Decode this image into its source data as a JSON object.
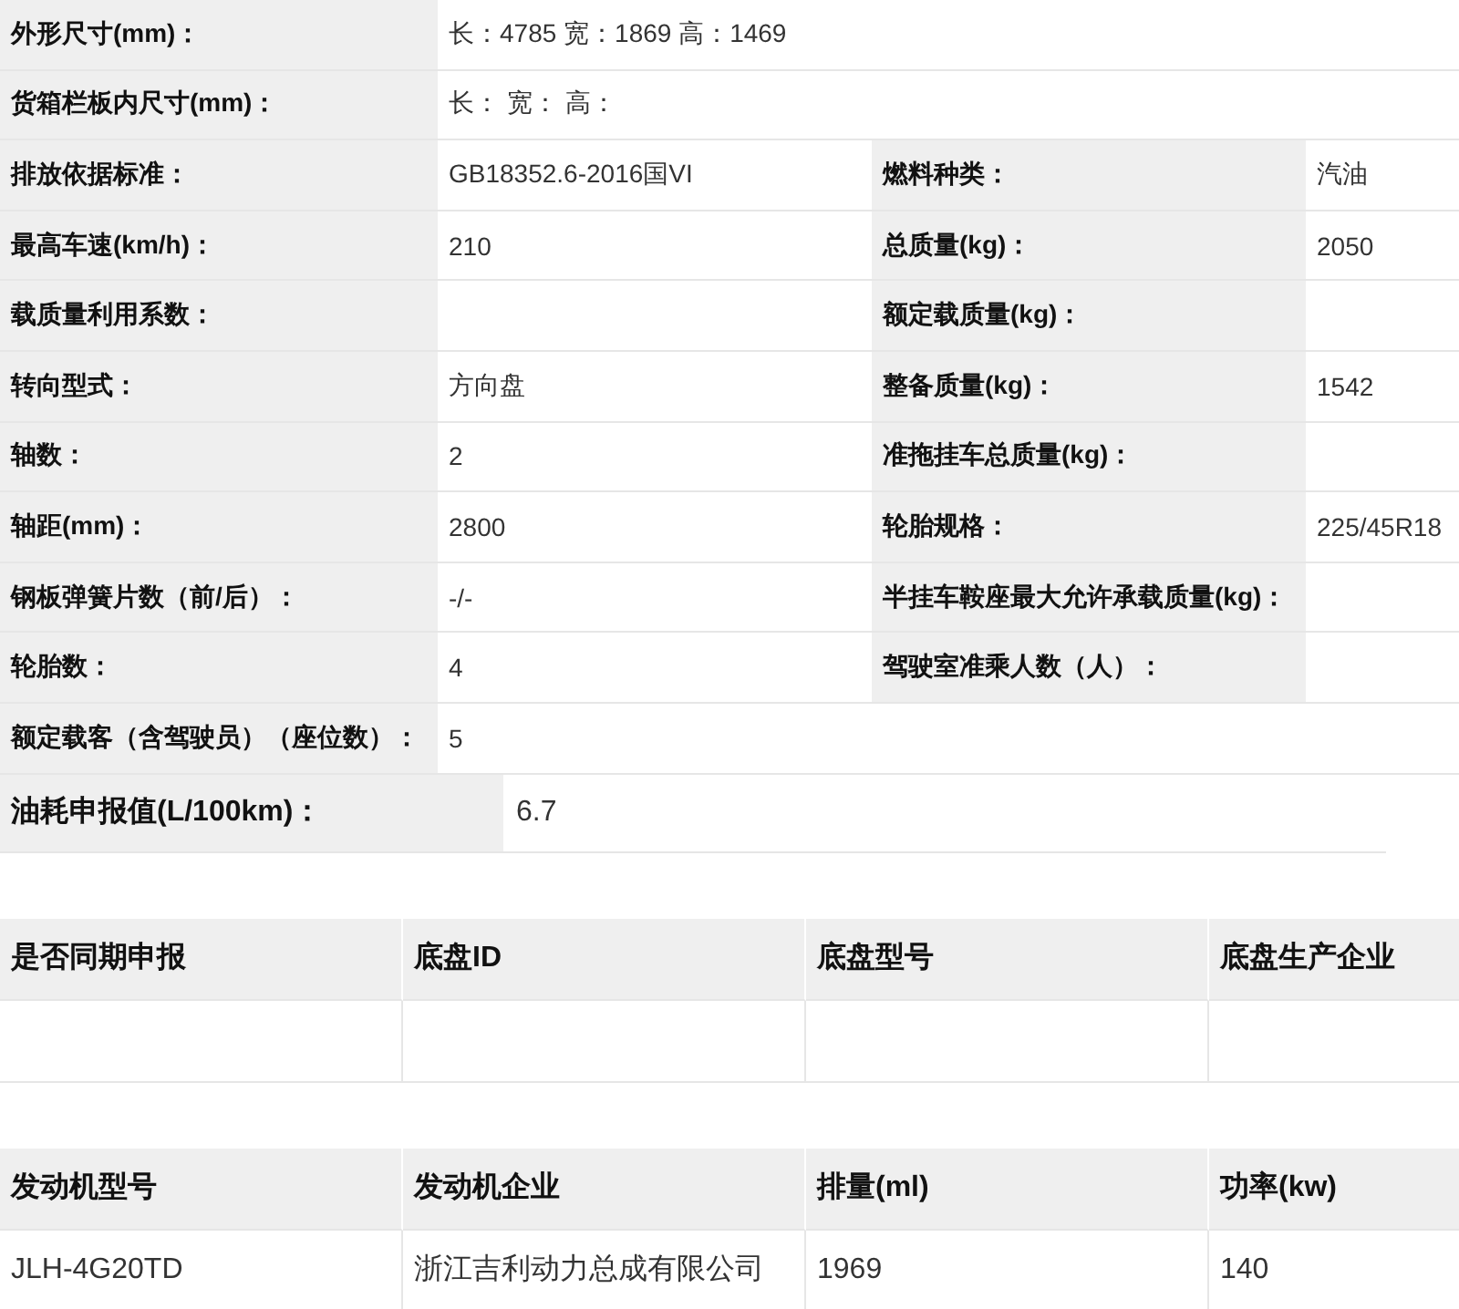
{
  "specs": [
    {
      "label": "外形尺寸(mm)：",
      "value": "长：4785 宽：1869 高：1469"
    },
    {
      "label": "货箱栏板内尺寸(mm)：",
      "value": "长：  宽：  高："
    },
    {
      "label": "排放依据标准：",
      "value": "GB18352.6-2016国VI",
      "label_2": "燃料种类：",
      "value_2": "汽油"
    },
    {
      "label": "最高车速(km/h)：",
      "value": "210",
      "label_2": "总质量(kg)：",
      "value_2": "2050"
    },
    {
      "label": "载质量利用系数：",
      "label_2": "额定载质量(kg)："
    },
    {
      "label": "转向型式：",
      "value": "方向盘",
      "label_2": "整备质量(kg)：",
      "value_2": "1542"
    },
    {
      "label": "轴数：",
      "value": "2",
      "label_2": "准拖挂车总质量(kg)："
    },
    {
      "label": "轴距(mm)：",
      "value": "2800",
      "label_2": "轮胎规格：",
      "value_2": "225/45R18"
    },
    {
      "label": "钢板弹簧片数（前/后）：",
      "value": "-/-",
      "label_2": "半挂车鞍座最大允许承载质量(kg)："
    },
    {
      "label": "轮胎数：",
      "value": "4",
      "label_2": "驾驶室准乘人数（人）："
    },
    {
      "label": "额定载客（含驾驶员）（座位数）：",
      "value": "5"
    }
  ],
  "fuel_consumption": {
    "label": "油耗申报值(L/100km)：",
    "value": "6.7"
  },
  "chassis": {
    "columns": [
      "是否同期申报",
      "底盘ID",
      "底盘型号",
      "底盘生产企业"
    ]
  },
  "engine": {
    "columns": [
      "发动机型号",
      "发动机企业",
      "排量(ml)",
      "功率(kw)"
    ],
    "rows": [
      [
        "JLH-4G20TD",
        "浙江吉利动力总成有限公司",
        "1969",
        "140"
      ]
    ]
  }
}
